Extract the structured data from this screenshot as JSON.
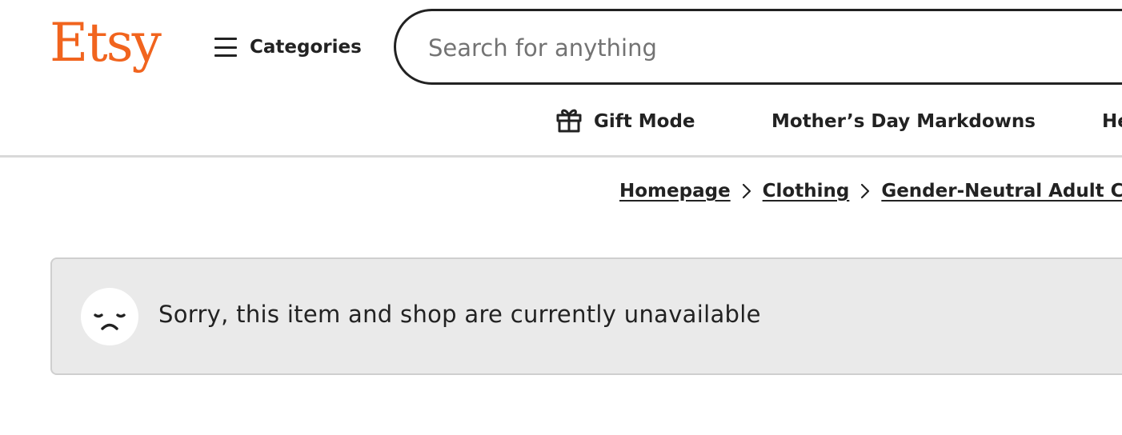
{
  "header": {
    "logo_text": "Etsy",
    "categories_label": "Categories",
    "search_placeholder": "Search for anything"
  },
  "nav": {
    "items": [
      {
        "label": "Gift Mode",
        "icon": "gift-icon"
      },
      {
        "label": "Mother’s Day Markdowns"
      },
      {
        "label": "He"
      }
    ]
  },
  "breadcrumb": [
    {
      "label": "Homepage"
    },
    {
      "label": "Clothing"
    },
    {
      "label": "Gender-Neutral Adult Cl"
    }
  ],
  "notice": {
    "icon": "sad-face-icon",
    "message": "Sorry, this item and shop are currently unavailable"
  },
  "colors": {
    "brand": "#f1641e",
    "text": "#222222",
    "notice_bg": "#eaeaea",
    "notice_border": "#cfcfcf"
  }
}
